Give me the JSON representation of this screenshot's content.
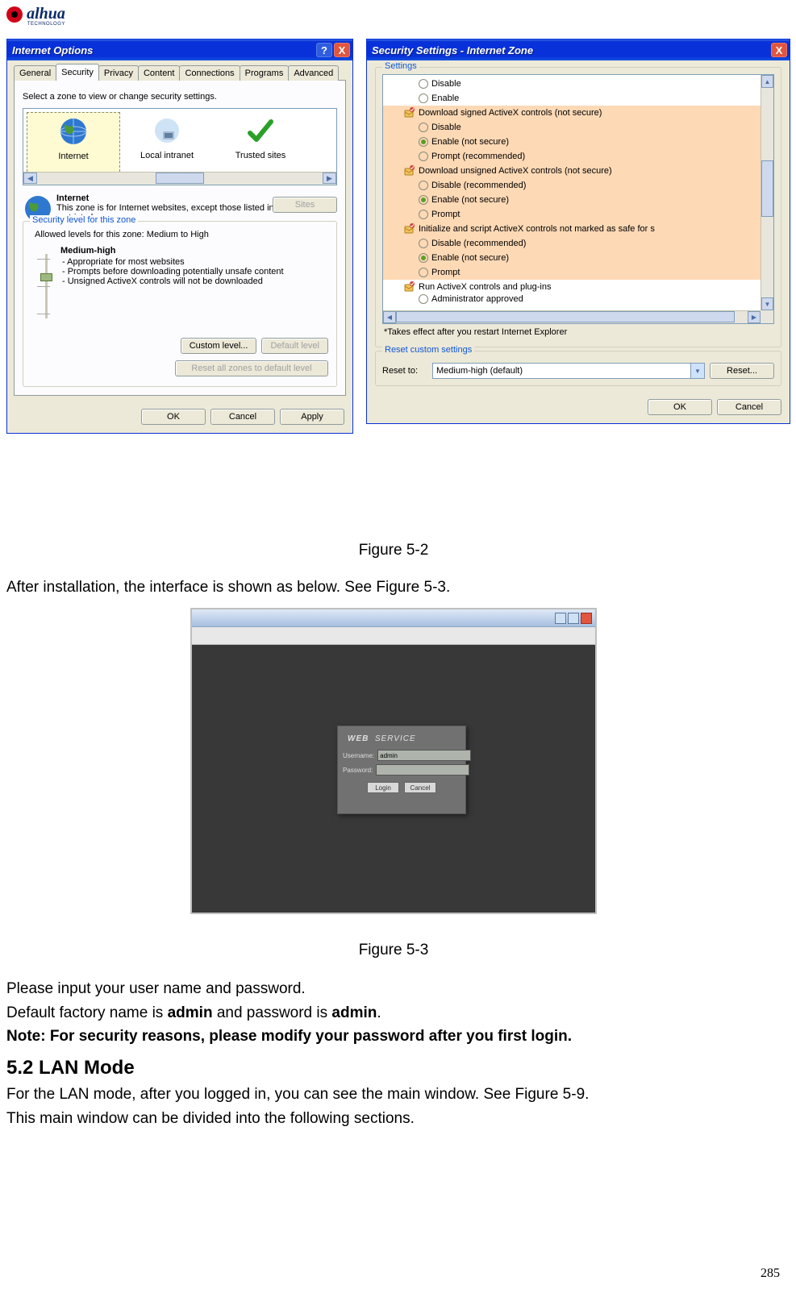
{
  "logo": {
    "brand": "alhua",
    "sub": "TECHNOLOGY"
  },
  "internet_options": {
    "title": "Internet Options",
    "tabs": [
      "General",
      "Security",
      "Privacy",
      "Content",
      "Connections",
      "Programs",
      "Advanced"
    ],
    "active_tab": "Security",
    "select_zone_text": "Select a zone to view or change security settings.",
    "zones": {
      "internet": "Internet",
      "intranet": "Local intranet",
      "trusted": "Trusted sites"
    },
    "zone_heading": "Internet",
    "zone_desc": "This zone is for Internet websites, except those listed in trusted and restricted zones.",
    "sites_btn": "Sites",
    "group_legend": "Security level for this zone",
    "allowed_levels": "Allowed levels for this zone: Medium to High",
    "level_name": "Medium-high",
    "level_points": [
      "- Appropriate for most websites",
      "- Prompts before downloading potentially unsafe content",
      "- Unsigned ActiveX controls will not be downloaded"
    ],
    "custom_btn": "Custom level...",
    "default_btn": "Default level",
    "reset_all_btn": "Reset all zones to default level",
    "ok": "OK",
    "cancel": "Cancel",
    "apply": "Apply"
  },
  "security_settings": {
    "title": "Security Settings - Internet Zone",
    "settings_legend": "Settings",
    "tree": [
      {
        "t": "opt",
        "label": "Disable",
        "sel": false
      },
      {
        "t": "opt",
        "label": "Enable",
        "sel": false
      },
      {
        "t": "cat",
        "label": "Download signed ActiveX controls (not secure)",
        "hilite": true
      },
      {
        "t": "opt",
        "label": "Disable",
        "sel": false,
        "hilite": true
      },
      {
        "t": "opt",
        "label": "Enable (not secure)",
        "sel": true,
        "hilite": true
      },
      {
        "t": "opt",
        "label": "Prompt (recommended)",
        "sel": false,
        "hilite": true
      },
      {
        "t": "cat",
        "label": "Download unsigned ActiveX controls (not secure)",
        "hilite": true
      },
      {
        "t": "opt",
        "label": "Disable (recommended)",
        "sel": false,
        "hilite": true
      },
      {
        "t": "opt",
        "label": "Enable (not secure)",
        "sel": true,
        "hilite": true
      },
      {
        "t": "opt",
        "label": "Prompt",
        "sel": false,
        "hilite": true
      },
      {
        "t": "cat",
        "label": "Initialize and script ActiveX controls not marked as safe for s",
        "hilite": true
      },
      {
        "t": "opt",
        "label": "Disable (recommended)",
        "sel": false,
        "hilite": true
      },
      {
        "t": "opt",
        "label": "Enable (not secure)",
        "sel": true,
        "hilite": true
      },
      {
        "t": "opt",
        "label": "Prompt",
        "sel": false,
        "hilite": true
      },
      {
        "t": "cat",
        "label": "Run ActiveX controls and plug-ins"
      },
      {
        "t": "opt",
        "label": "Administrator approved",
        "sel": false,
        "cut": true
      }
    ],
    "restart_note": "*Takes effect after you restart Internet Explorer",
    "reset_legend": "Reset custom settings",
    "reset_to_label": "Reset to:",
    "reset_value": "Medium-high (default)",
    "reset_btn": "Reset...",
    "ok": "OK",
    "cancel": "Cancel"
  },
  "figure52": "Figure 5-2",
  "after_install": "After installation, the interface is shown as below. See Figure 5-3.",
  "web_service": {
    "heading": "WEB  SERVICE",
    "user_label": "Username:",
    "pass_label": "Password:",
    "user_value": "admin",
    "login": "Login",
    "cancel": "Cancel"
  },
  "figure53": "Figure 5-3",
  "body": {
    "p1": "Please input your user name and password.",
    "p2a": "Default factory name is ",
    "p2b": "admin",
    "p2c": " and password is ",
    "p2d": "admin",
    "p2e": ".",
    "note": "Note: For security reasons, please modify your password after you first login.",
    "h2": "5.2  LAN Mode",
    "p3": "For the LAN mode, after you logged in, you can see the main window. See Figure 5-9.",
    "p4": "This main window can be divided into the following sections."
  },
  "page_number": "285"
}
